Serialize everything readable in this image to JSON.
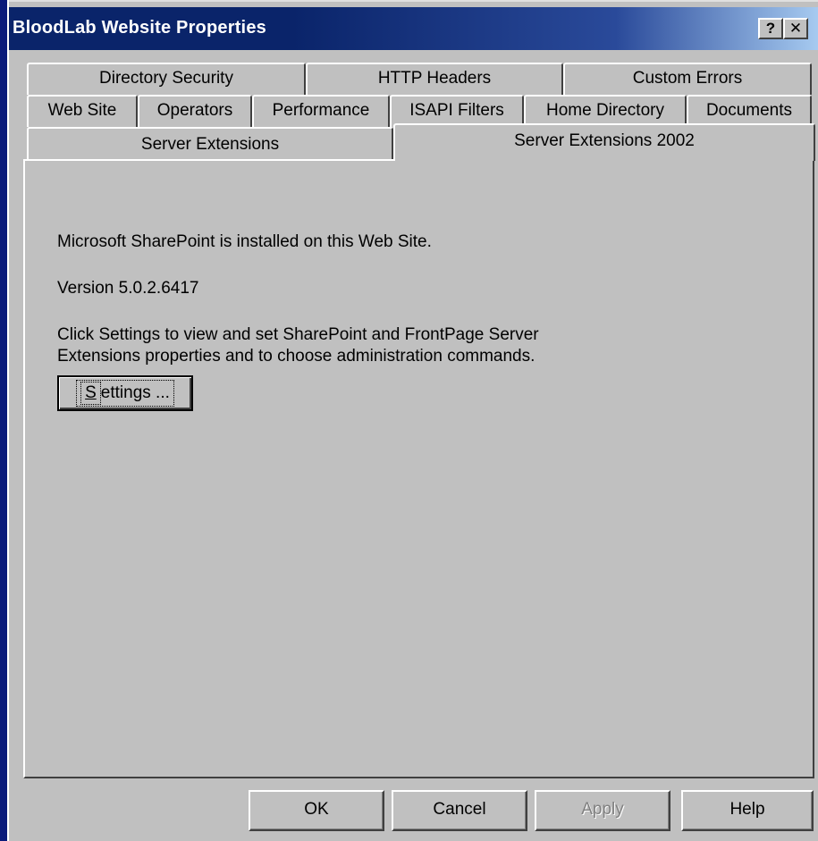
{
  "window": {
    "title": "BloodLab Website Properties",
    "help_glyph": "?",
    "close_glyph": "✕"
  },
  "tabs": {
    "row1": [
      "Directory Security",
      "HTTP Headers",
      "Custom Errors"
    ],
    "row2": [
      "Web Site",
      "Operators",
      "Performance",
      "ISAPI Filters",
      "Home Directory",
      "Documents"
    ],
    "row3": [
      "Server Extensions",
      "Server Extensions 2002"
    ],
    "active": "Server Extensions 2002"
  },
  "panel": {
    "installed_text": "Microsoft SharePoint is installed on this Web Site.",
    "version_text": "Version 5.0.2.6417",
    "instructions_line1": "Click Settings to view and set SharePoint and FrontPage Server",
    "instructions_line2": "Extensions properties and to choose administration commands.",
    "settings_mnemonic": "S",
    "settings_rest": "ettings ..."
  },
  "buttons": {
    "ok": "OK",
    "cancel": "Cancel",
    "apply": "Apply",
    "help": "Help"
  }
}
